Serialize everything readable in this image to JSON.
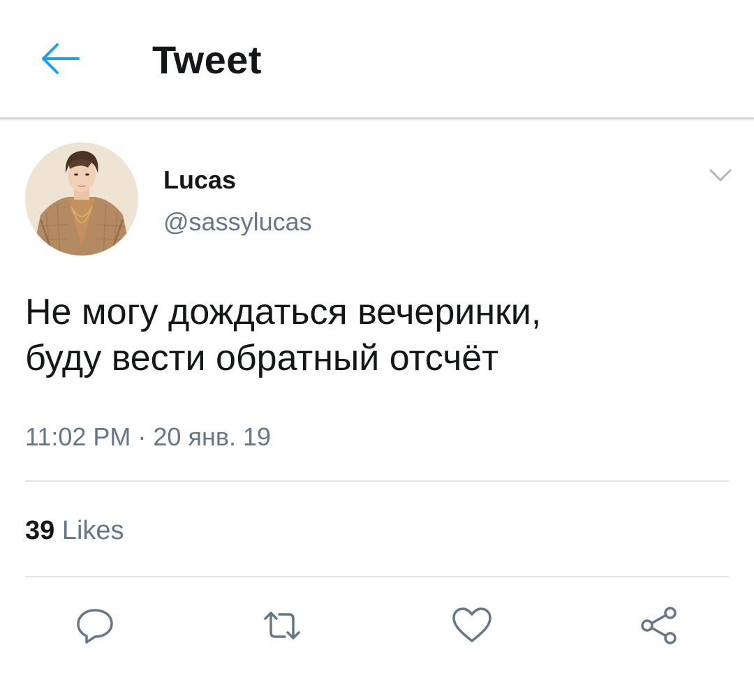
{
  "header": {
    "title": "Tweet",
    "back_icon": "arrow-left-icon",
    "accent_color": "#1da1f2"
  },
  "tweet": {
    "author": {
      "display_name": "Lucas",
      "handle": "@sassylucas",
      "avatar_icon": "avatar-photo"
    },
    "menu_icon": "chevron-down-icon",
    "text_line1": "Не могу дождаться вечеринки,",
    "text_line2": "буду вести обратный отсчёт",
    "timestamp": "11:02 PM · 20 янв. 19",
    "stats": {
      "likes_count": "39",
      "likes_label": "Likes"
    }
  },
  "actions": [
    {
      "name": "reply",
      "icon": "reply-icon"
    },
    {
      "name": "retweet",
      "icon": "retweet-icon"
    },
    {
      "name": "like",
      "icon": "heart-icon"
    },
    {
      "name": "share",
      "icon": "share-icon"
    }
  ],
  "colors": {
    "text_primary": "#14171a",
    "text_secondary": "#657786",
    "divider": "#e1e8ed",
    "icon_gray": "#657786"
  }
}
